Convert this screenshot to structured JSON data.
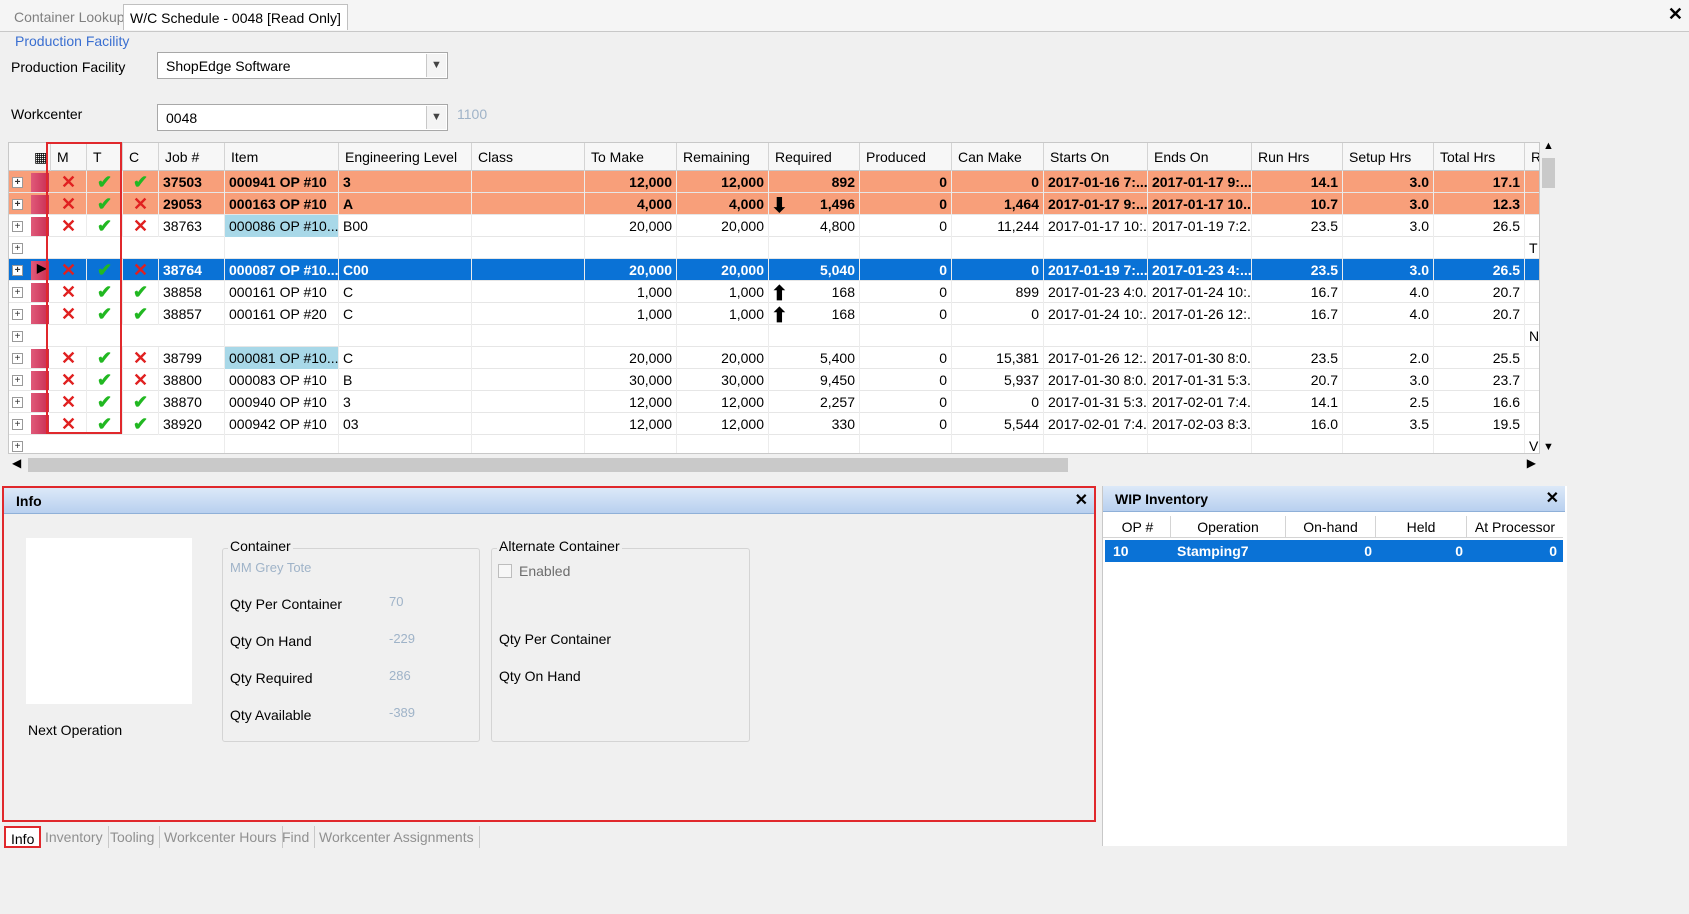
{
  "tabs": [
    {
      "label": "Container Lookup",
      "active": false
    },
    {
      "label": "W/C Schedule - 0048 [Read Only]",
      "active": true
    }
  ],
  "close_glyph": "✕",
  "facility_group_title": "Production Facility",
  "facility_label": "Production Facility",
  "facility_value": "ShopEdge Software",
  "workcenter_label": "Workcenter",
  "workcenter_value": "0048",
  "workcenter_extra": "1100",
  "grid": {
    "columns": [
      "M",
      "T",
      "C",
      "Job #",
      "Item",
      "Engineering Level",
      "Class",
      "To Make",
      "Remaining",
      "Required",
      "Produced",
      "Can Make",
      "Starts On",
      "Ends On",
      "Run Hrs",
      "Setup Hrs",
      "Total Hrs",
      "R"
    ],
    "rows": [
      {
        "style": "orange",
        "m": "x",
        "t": "ok",
        "c": "ok",
        "job": "37503",
        "item": "000941 OP #10",
        "eng": "3",
        "cls": "",
        "to_make": "12,000",
        "remaining": "12,000",
        "arrow": "",
        "required": "892",
        "produced": "0",
        "can_make": "0",
        "starts": "2017-01-16 7:...",
        "ends": "2017-01-17 9:...",
        "run": "14.1",
        "setup": "3.0",
        "total": "17.1",
        "r": ""
      },
      {
        "style": "orange",
        "m": "x",
        "t": "ok",
        "c": "x",
        "job": "29053",
        "item": "000163 OP #10",
        "eng": "A",
        "cls": "",
        "to_make": "4,000",
        "remaining": "4,000",
        "arrow": "down",
        "required": "1,496",
        "produced": "0",
        "can_make": "1,464",
        "starts": "2017-01-17 9:...",
        "ends": "2017-01-17 10...",
        "run": "10.7",
        "setup": "3.0",
        "total": "12.3",
        "r": ""
      },
      {
        "style": "normal",
        "m": "x",
        "t": "ok",
        "c": "x",
        "job": "38763",
        "item": "000086 OP #10...",
        "item_hl": true,
        "eng": "B00",
        "cls": "",
        "to_make": "20,000",
        "remaining": "20,000",
        "arrow": "",
        "required": "4,800",
        "produced": "0",
        "can_make": "11,244",
        "starts": "2017-01-17 10:...",
        "ends": "2017-01-19 7:2...",
        "run": "23.5",
        "setup": "3.0",
        "total": "26.5",
        "r": ""
      },
      {
        "style": "blank",
        "r": "T"
      },
      {
        "style": "selected",
        "pointer": true,
        "m": "x",
        "t": "ok",
        "c": "x",
        "job": "38764",
        "item": "000087 OP #10...",
        "eng": "C00",
        "cls": "",
        "to_make": "20,000",
        "remaining": "20,000",
        "arrow": "",
        "required": "5,040",
        "produced": "0",
        "can_make": "0",
        "starts": "2017-01-19 7:...",
        "ends": "2017-01-23 4:...",
        "run": "23.5",
        "setup": "3.0",
        "total": "26.5",
        "r": ""
      },
      {
        "style": "normal",
        "m": "x",
        "t": "ok",
        "c": "ok",
        "job": "38858",
        "item": "000161 OP #10",
        "eng": "C",
        "cls": "",
        "to_make": "1,000",
        "remaining": "1,000",
        "arrow": "up",
        "required": "168",
        "produced": "0",
        "can_make": "899",
        "starts": "2017-01-23 4:0...",
        "ends": "2017-01-24 10:...",
        "run": "16.7",
        "setup": "4.0",
        "total": "20.7",
        "r": ""
      },
      {
        "style": "normal",
        "m": "x",
        "t": "ok",
        "c": "ok",
        "job": "38857",
        "item": "000161 OP #20",
        "eng": "C",
        "cls": "",
        "to_make": "1,000",
        "remaining": "1,000",
        "arrow": "up",
        "required": "168",
        "produced": "0",
        "can_make": "0",
        "starts": "2017-01-24 10:...",
        "ends": "2017-01-26 12:...",
        "run": "16.7",
        "setup": "4.0",
        "total": "20.7",
        "r": ""
      },
      {
        "style": "blank",
        "r": "N"
      },
      {
        "style": "normal",
        "m": "x",
        "t": "ok",
        "c": "x",
        "job": "38799",
        "item": "000081 OP #10...",
        "item_hl": true,
        "eng": "C",
        "cls": "",
        "to_make": "20,000",
        "remaining": "20,000",
        "arrow": "",
        "required": "5,400",
        "produced": "0",
        "can_make": "15,381",
        "starts": "2017-01-26 12:...",
        "ends": "2017-01-30 8:0...",
        "run": "23.5",
        "setup": "2.0",
        "total": "25.5",
        "r": ""
      },
      {
        "style": "normal",
        "m": "x",
        "t": "ok",
        "c": "x",
        "job": "38800",
        "item": "000083 OP #10",
        "eng": "B",
        "cls": "",
        "to_make": "30,000",
        "remaining": "30,000",
        "arrow": "",
        "required": "9,450",
        "produced": "0",
        "can_make": "5,937",
        "starts": "2017-01-30 8:0...",
        "ends": "2017-01-31 5:3...",
        "run": "20.7",
        "setup": "3.0",
        "total": "23.7",
        "r": ""
      },
      {
        "style": "normal",
        "m": "x",
        "t": "ok",
        "c": "ok",
        "job": "38870",
        "item": "000940 OP #10",
        "eng": "3",
        "cls": "",
        "to_make": "12,000",
        "remaining": "12,000",
        "arrow": "",
        "required": "2,257",
        "produced": "0",
        "can_make": "0",
        "starts": "2017-01-31 5:3...",
        "ends": "2017-02-01 7:4...",
        "run": "14.1",
        "setup": "2.5",
        "total": "16.6",
        "r": ""
      },
      {
        "style": "normal",
        "m": "x",
        "t": "ok",
        "c": "ok",
        "job": "38920",
        "item": "000942 OP #10",
        "eng": "03",
        "cls": "",
        "to_make": "12,000",
        "remaining": "12,000",
        "arrow": "",
        "required": "330",
        "produced": "0",
        "can_make": "5,544",
        "starts": "2017-02-01 7:4...",
        "ends": "2017-02-03 8:3...",
        "run": "16.0",
        "setup": "3.5",
        "total": "19.5",
        "r": ""
      },
      {
        "style": "blank",
        "r": "V"
      }
    ]
  },
  "info": {
    "title": "Info",
    "next_operation_label": "Next Operation",
    "container_title": "Container",
    "container_value": "MM Grey Tote",
    "qty_per_container_label": "Qty Per Container",
    "qty_per_container_value": "70",
    "qty_on_hand_label": "Qty On Hand",
    "qty_on_hand_value": "-229",
    "qty_required_label": "Qty Required",
    "qty_required_value": "286",
    "qty_available_label": "Qty Available",
    "qty_available_value": "-389",
    "alt_title": "Alternate Container",
    "enabled_label": "Enabled",
    "alt_qty_per_container_label": "Qty Per Container",
    "alt_qty_on_hand_label": "Qty On Hand"
  },
  "wip": {
    "title": "WIP Inventory",
    "columns": [
      "OP #",
      "Operation",
      "On-hand",
      "Held",
      "At Processor"
    ],
    "row": {
      "op": "10",
      "operation": "Stamping7",
      "on_hand": "0",
      "held": "0",
      "at_processor": "0"
    }
  },
  "bottom_tabs": [
    "Info",
    "Inventory",
    "Tooling",
    "Workcenter Hours",
    "Find",
    "Workcenter Assignments"
  ]
}
